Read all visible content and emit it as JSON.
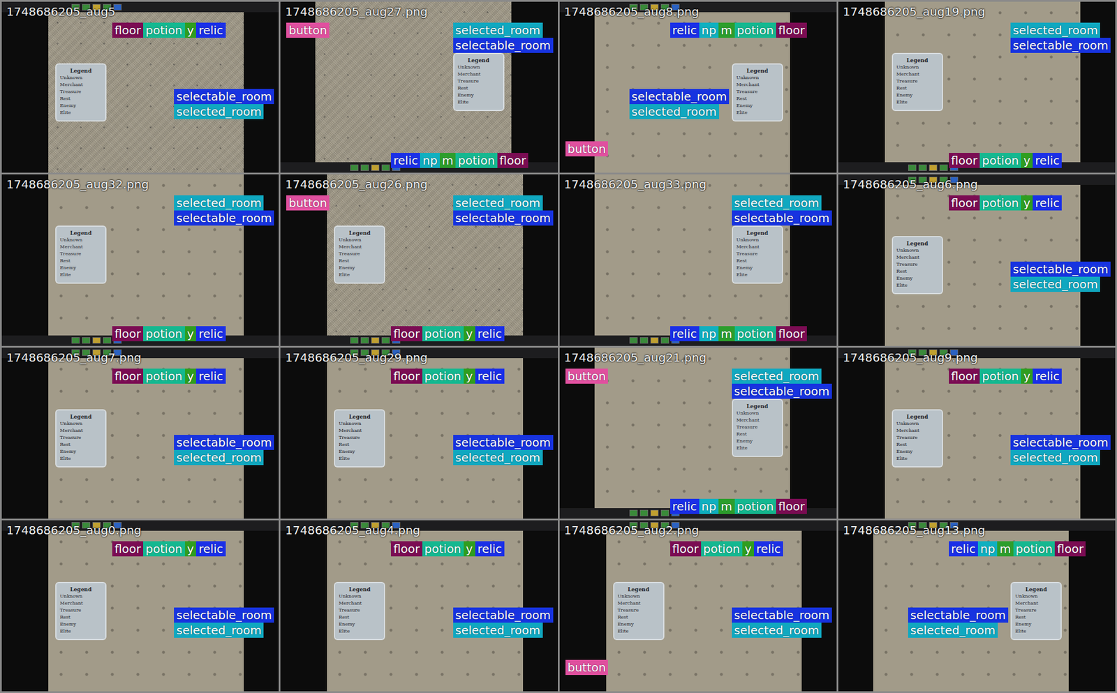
{
  "legend": {
    "title": "Legend",
    "entries": [
      "Unknown",
      "Merchant",
      "Treasure",
      "Rest",
      "Enemy",
      "Elite"
    ]
  },
  "tiles": [
    {
      "filename": "1748686205_aug5",
      "kind": "hud-top",
      "mirrored": false,
      "noisy": true,
      "hud": [
        {
          "text": "floor",
          "color": "#7b0c53"
        },
        {
          "text": "potion",
          "color": "#14b890"
        },
        {
          "text": "y",
          "color": "#2f9e1f"
        },
        {
          "text": "relic",
          "color": "#1a2fe8"
        }
      ],
      "rooms": [
        {
          "text": "selectable_room",
          "color": "#1733e0"
        },
        {
          "text": "selected_room",
          "color": "#10a8c0"
        }
      ],
      "buttons": []
    },
    {
      "filename": "1748686205_aug27.png",
      "kind": "hud-bottom",
      "mirrored": false,
      "noisy": true,
      "hud": [
        {
          "text": "relic",
          "color": "#1a2fe8"
        },
        {
          "text": "np",
          "color": "#0fb0c0"
        },
        {
          "text": "m",
          "color": "#2c9e2c"
        },
        {
          "text": "potion",
          "color": "#14b890"
        },
        {
          "text": "floor",
          "color": "#7b0c53"
        }
      ],
      "rooms": [
        {
          "text": "selected_room",
          "color": "#10a8c0"
        },
        {
          "text": "selectable_room",
          "color": "#1733e0"
        }
      ],
      "buttons": [
        {
          "text": "button",
          "color": "#e0509f"
        }
      ]
    },
    {
      "filename": "1748686205_aug8.png",
      "kind": "hud-top",
      "mirrored": true,
      "noisy": false,
      "hud": [
        {
          "text": "relic",
          "color": "#1a2fe8"
        },
        {
          "text": "np",
          "color": "#0fb0c0"
        },
        {
          "text": "m",
          "color": "#2c9e2c"
        },
        {
          "text": "potion",
          "color": "#14b890"
        },
        {
          "text": "floor",
          "color": "#7b0c53"
        }
      ],
      "rooms": [
        {
          "text": "selectable_room",
          "color": "#1733e0"
        },
        {
          "text": "selected_room",
          "color": "#10a8c0"
        }
      ],
      "buttons": [
        {
          "text": "button",
          "color": "#e0509f"
        }
      ]
    },
    {
      "filename": "1748686205_aug19.png",
      "kind": "hud-bottom",
      "mirrored": true,
      "noisy": false,
      "hud": [
        {
          "text": "floor",
          "color": "#7b0c53"
        },
        {
          "text": "potion",
          "color": "#14b890"
        },
        {
          "text": "y",
          "color": "#2f9e1f"
        },
        {
          "text": "relic",
          "color": "#1a2fe8"
        }
      ],
      "rooms": [
        {
          "text": "selected_room",
          "color": "#10a8c0"
        },
        {
          "text": "selectable_room",
          "color": "#1733e0"
        }
      ],
      "buttons": []
    },
    {
      "filename": "1748686205_aug32.png",
      "kind": "hud-bottom",
      "mirrored": true,
      "noisy": false,
      "hud": [
        {
          "text": "floor",
          "color": "#7b0c53"
        },
        {
          "text": "potion",
          "color": "#14b890"
        },
        {
          "text": "y",
          "color": "#2f9e1f"
        },
        {
          "text": "relic",
          "color": "#1a2fe8"
        }
      ],
      "rooms": [
        {
          "text": "selected_room",
          "color": "#10a8c0"
        },
        {
          "text": "selectable_room",
          "color": "#1733e0"
        }
      ],
      "buttons": []
    },
    {
      "filename": "1748686205_aug26.png",
      "kind": "hud-bottom",
      "mirrored": true,
      "noisy": true,
      "hud": [
        {
          "text": "floor",
          "color": "#7b0c53"
        },
        {
          "text": "potion",
          "color": "#14b890"
        },
        {
          "text": "y",
          "color": "#2f9e1f"
        },
        {
          "text": "relic",
          "color": "#1a2fe8"
        }
      ],
      "rooms": [
        {
          "text": "selected_room",
          "color": "#10a8c0"
        },
        {
          "text": "selectable_room",
          "color": "#1733e0"
        }
      ],
      "buttons": [
        {
          "text": "button",
          "color": "#e0509f"
        }
      ]
    },
    {
      "filename": "1748686205_aug33.png",
      "kind": "hud-bottom",
      "mirrored": false,
      "noisy": false,
      "hud": [
        {
          "text": "relic",
          "color": "#1a2fe8"
        },
        {
          "text": "np",
          "color": "#0fb0c0"
        },
        {
          "text": "m",
          "color": "#2c9e2c"
        },
        {
          "text": "potion",
          "color": "#14b890"
        },
        {
          "text": "floor",
          "color": "#7b0c53"
        }
      ],
      "rooms": [
        {
          "text": "selected_room",
          "color": "#10a8c0"
        },
        {
          "text": "selectable_room",
          "color": "#1733e0"
        }
      ],
      "buttons": []
    },
    {
      "filename": "1748686205_aug6.png",
      "kind": "hud-top",
      "mirrored": false,
      "noisy": false,
      "hud": [
        {
          "text": "floor",
          "color": "#7b0c53"
        },
        {
          "text": "potion",
          "color": "#14b890"
        },
        {
          "text": "y",
          "color": "#2f9e1f"
        },
        {
          "text": "relic",
          "color": "#1a2fe8"
        }
      ],
      "rooms": [
        {
          "text": "selectable_room",
          "color": "#1733e0"
        },
        {
          "text": "selected_room",
          "color": "#10a8c0"
        }
      ],
      "buttons": []
    },
    {
      "filename": "1748686205_aug7.png",
      "kind": "hud-top",
      "mirrored": false,
      "noisy": false,
      "hud": [
        {
          "text": "floor",
          "color": "#7b0c53"
        },
        {
          "text": "potion",
          "color": "#14b890"
        },
        {
          "text": "y",
          "color": "#2f9e1f"
        },
        {
          "text": "relic",
          "color": "#1a2fe8"
        }
      ],
      "rooms": [
        {
          "text": "selectable_room",
          "color": "#1733e0"
        },
        {
          "text": "selected_room",
          "color": "#10a8c0"
        }
      ],
      "buttons": []
    },
    {
      "filename": "1748686205_aug29.png",
      "kind": "hud-top",
      "mirrored": false,
      "noisy": false,
      "hud": [
        {
          "text": "floor",
          "color": "#7b0c53"
        },
        {
          "text": "potion",
          "color": "#14b890"
        },
        {
          "text": "y",
          "color": "#2f9e1f"
        },
        {
          "text": "relic",
          "color": "#1a2fe8"
        }
      ],
      "rooms": [
        {
          "text": "selectable_room",
          "color": "#1733e0"
        },
        {
          "text": "selected_room",
          "color": "#10a8c0"
        }
      ],
      "buttons": []
    },
    {
      "filename": "1748686205_aug21.png",
      "kind": "hud-bottom",
      "mirrored": false,
      "noisy": false,
      "hud": [
        {
          "text": "relic",
          "color": "#1a2fe8"
        },
        {
          "text": "np",
          "color": "#0fb0c0"
        },
        {
          "text": "m",
          "color": "#2c9e2c"
        },
        {
          "text": "potion",
          "color": "#14b890"
        },
        {
          "text": "floor",
          "color": "#7b0c53"
        }
      ],
      "rooms": [
        {
          "text": "selected_room",
          "color": "#10a8c0"
        },
        {
          "text": "selectable_room",
          "color": "#1733e0"
        }
      ],
      "buttons": [
        {
          "text": "button",
          "color": "#e0509f"
        }
      ]
    },
    {
      "filename": "1748686205_aug9.png",
      "kind": "hud-top",
      "mirrored": false,
      "noisy": false,
      "hud": [
        {
          "text": "floor",
          "color": "#7b0c53"
        },
        {
          "text": "potion",
          "color": "#14b890"
        },
        {
          "text": "y",
          "color": "#2f9e1f"
        },
        {
          "text": "relic",
          "color": "#1a2fe8"
        }
      ],
      "rooms": [
        {
          "text": "selectable_room",
          "color": "#1733e0"
        },
        {
          "text": "selected_room",
          "color": "#10a8c0"
        }
      ],
      "buttons": []
    },
    {
      "filename": "1748686205_aug0.png",
      "kind": "hud-top",
      "mirrored": false,
      "noisy": false,
      "hud": [
        {
          "text": "floor",
          "color": "#7b0c53"
        },
        {
          "text": "potion",
          "color": "#14b890"
        },
        {
          "text": "y",
          "color": "#2f9e1f"
        },
        {
          "text": "relic",
          "color": "#1a2fe8"
        }
      ],
      "rooms": [
        {
          "text": "selectable_room",
          "color": "#1733e0"
        },
        {
          "text": "selected_room",
          "color": "#10a8c0"
        }
      ],
      "buttons": []
    },
    {
      "filename": "1748686205_aug4.png",
      "kind": "hud-top",
      "mirrored": false,
      "noisy": false,
      "hud": [
        {
          "text": "floor",
          "color": "#7b0c53"
        },
        {
          "text": "potion",
          "color": "#14b890"
        },
        {
          "text": "y",
          "color": "#2f9e1f"
        },
        {
          "text": "relic",
          "color": "#1a2fe8"
        }
      ],
      "rooms": [
        {
          "text": "selectable_room",
          "color": "#1733e0"
        },
        {
          "text": "selected_room",
          "color": "#10a8c0"
        }
      ],
      "buttons": []
    },
    {
      "filename": "1748686205_aug2.png",
      "kind": "hud-top",
      "mirrored": false,
      "noisy": false,
      "hud": [
        {
          "text": "floor",
          "color": "#7b0c53"
        },
        {
          "text": "potion",
          "color": "#14b890"
        },
        {
          "text": "y",
          "color": "#2f9e1f"
        },
        {
          "text": "relic",
          "color": "#1a2fe8"
        }
      ],
      "rooms": [
        {
          "text": "selectable_room",
          "color": "#1733e0"
        },
        {
          "text": "selected_room",
          "color": "#10a8c0"
        }
      ],
      "buttons": [
        {
          "text": "button",
          "color": "#e0509f"
        }
      ]
    },
    {
      "filename": "1748686205_aug13.png",
      "kind": "hud-top",
      "mirrored": true,
      "noisy": false,
      "hud": [
        {
          "text": "relic",
          "color": "#1a2fe8"
        },
        {
          "text": "np",
          "color": "#0fb0c0"
        },
        {
          "text": "m",
          "color": "#2c9e2c"
        },
        {
          "text": "potion",
          "color": "#14b890"
        },
        {
          "text": "floor",
          "color": "#7b0c53"
        }
      ],
      "rooms": [
        {
          "text": "selectable_room",
          "color": "#1733e0"
        },
        {
          "text": "selected_room",
          "color": "#10a8c0"
        }
      ],
      "buttons": []
    }
  ]
}
